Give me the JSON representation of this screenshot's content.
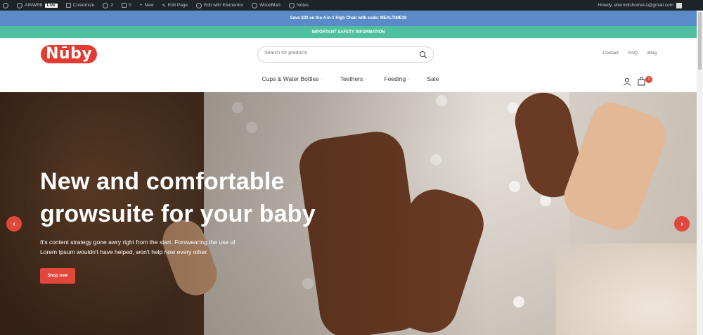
{
  "adminbar": {
    "site": "AINWEB",
    "live": "Live",
    "customize": "Customize",
    "updates": "2",
    "comments": "0",
    "new": "New",
    "edit_page": "Edit Page",
    "edit_elementor": "Edit with Elementor",
    "woomart": "WoodMart",
    "notes": "Notes",
    "greeting": "Howdy, ellermillshomes1@gmail.com"
  },
  "promo": {
    "top": "Save $30 on the 4-in-1 High Chair with code: MEALTIME30",
    "safety": "IMPORTANT SAFETY INFORMATION"
  },
  "header": {
    "logo": "Nūby",
    "search_placeholder": "Search for products",
    "links": [
      "Contact",
      "FAQ",
      "Blog"
    ],
    "nav": [
      "Cups & Water Bottles",
      "Teethers",
      "Feeding",
      "Sale"
    ],
    "cart_count": "1"
  },
  "hero": {
    "title": "New and comfortable growsuite for your baby",
    "text": "It's content strategy gone awry right from the start. Forswearing the use of Lorem Ipsum wouldn't have helped, won't help now every other.",
    "button": "Shop now"
  },
  "colors": {
    "accent": "#e2473c",
    "promo_blue": "#5b8ac9",
    "promo_teal": "#4fbfa0",
    "adminbar": "#1d2327"
  }
}
